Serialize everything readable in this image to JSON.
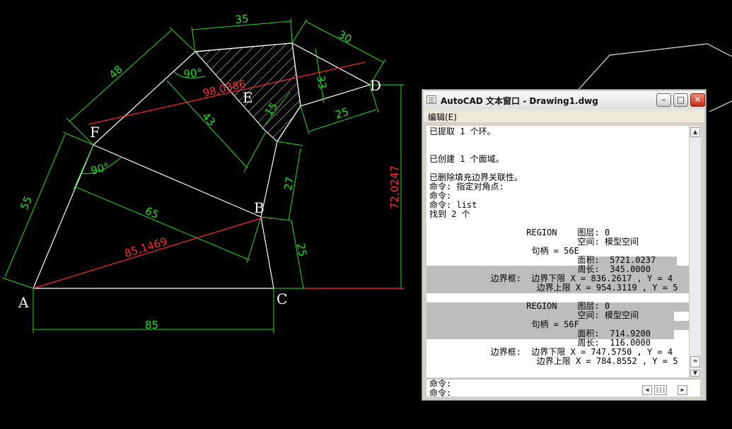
{
  "drawing": {
    "dims": {
      "d35": "35",
      "d30": "30",
      "d48": "48",
      "d90a": "90°",
      "d98": "98,0386",
      "d33": "33",
      "d43": "43",
      "d15": "15",
      "d25a": "25",
      "d90b": "90°",
      "d55": "55",
      "d65": "65",
      "d85a": "85,1469",
      "d27": "27",
      "d25b": "25",
      "d72": "72,0247",
      "d85b": "85"
    },
    "points": {
      "A": "A",
      "B": "B",
      "C": "C",
      "D": "D",
      "E": "E",
      "F": "F"
    }
  },
  "textwindow": {
    "title": "AutoCAD 文本窗口 - Drawing1.dwg",
    "menu": "编辑(E)",
    "lines": [
      "已提取 1 个环。",
      "",
      "",
      "已创建 1 个面域。",
      "",
      "已删除填充边界关联性。",
      "命令: 指定对角点:",
      "命令:",
      "命令: list",
      "找到 2 个",
      "",
      "                   REGION    图层: 0",
      "                             空间: 模型空间",
      "                    句柄 = 56E",
      "                             面积:  5721.0237",
      "                             周长:  345.0000",
      "            边界框:  边界下限 X = 836.2617 , Y = 4",
      "                     边界上限 X = 954.3119 , Y = 5",
      "",
      "                   REGION    图层: 0",
      "                             空间: 模型空间",
      "                    句柄 = 56F",
      "                             面积:  714.9200",
      "                             周长:  116.0000",
      "            边界框:  边界下限 X = 747.5750 , Y = 4",
      "                     边界上限 X = 784.8552 , Y = 5"
    ],
    "cmd_lines": [
      "命令:",
      "命令:"
    ],
    "buttons": {
      "minimize": "–",
      "maximize": "□",
      "close": "✕"
    }
  }
}
